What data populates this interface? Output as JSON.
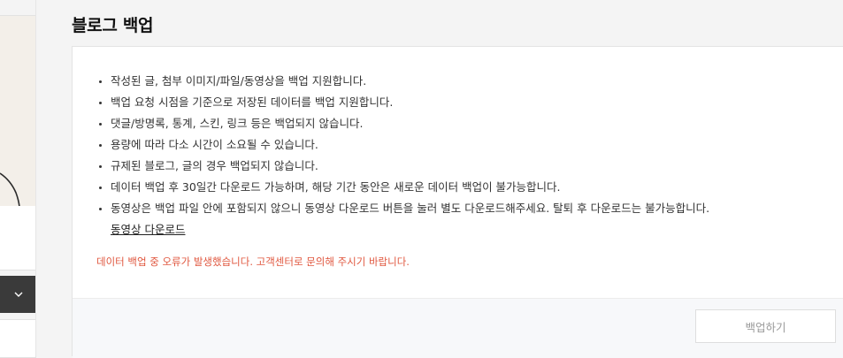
{
  "page": {
    "title": "블로그 백업"
  },
  "notices": [
    "작성된 글, 첨부 이미지/파일/동영상을 백업 지원합니다.",
    "백업 요청 시점을 기준으로 저장된 데이터를 백업 지원합니다.",
    "댓글/방명록, 통계, 스킨, 링크 등은 백업되지 않습니다.",
    "용량에 따라 다소 시간이 소요될 수 있습니다.",
    "규제된 블로그, 글의 경우 백업되지 않습니다.",
    "데이터 백업 후 30일간 다운로드 가능하며, 해당 기간 동안은 새로운 데이터 백업이 불가능합니다.",
    "동영상은 백업 파일 안에 포함되지 않으니 동영상 다운로드 버튼을 눌러 별도 다운로드해주세요. 탈퇴 후 다운로드는 불가능합니다."
  ],
  "video_download_link": "동영상 다운로드",
  "error_message": "데이터 백업 중 오류가 발생했습니다. 고객센터로 문의해 주시기 바랍니다.",
  "backup_button": "백업하기",
  "sidebar": {
    "dropdown_icon": "chevron-down-icon"
  },
  "colors": {
    "error": "#e0573f",
    "dropdown_bg": "#3a3a3a",
    "button_text_disabled": "#999999"
  }
}
